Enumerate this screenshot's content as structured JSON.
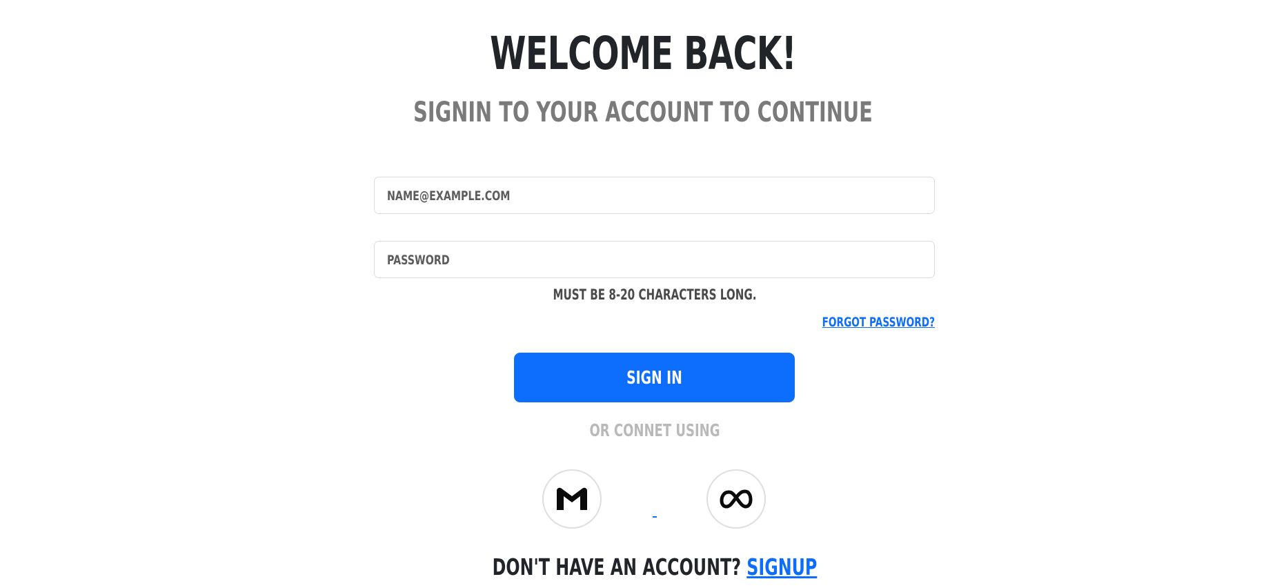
{
  "header": {
    "title": "WELCOME BACK!",
    "subtitle": "SIGNIN TO YOUR ACCOUNT TO CONTINUE"
  },
  "form": {
    "email_placeholder": "NAME@EXAMPLE.COM",
    "password_placeholder": "PASSWORD",
    "password_hint": "MUST BE 8-20 CHARACTERS LONG.",
    "forgot_label": "FORGOT PASSWORD?",
    "signin_label": "SIGN IN"
  },
  "social": {
    "divider_text": "OR CONNET USING",
    "providers": [
      {
        "icon": "gmail-icon"
      },
      {
        "icon": "meta-icon"
      }
    ]
  },
  "footer": {
    "prompt": "DON'T HAVE AN ACCOUNT?",
    "signup_label": "SIGNUP"
  },
  "colors": {
    "accent": "#0d6efd",
    "heading": "#212529",
    "subtitle": "#7a7a7a",
    "muted": "#b9b9b9"
  }
}
